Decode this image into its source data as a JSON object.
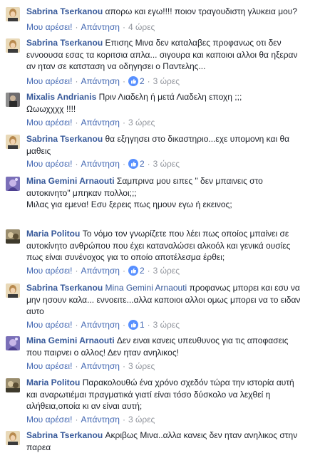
{
  "actions": {
    "like": "Μου αρέσει!",
    "reply": "Απάντηση",
    "sep": "·"
  },
  "colors": {
    "name": "#365899",
    "link": "#4267b2",
    "meta": "#90949c",
    "text": "#1d2129",
    "like_badge": "#5890ff"
  },
  "comments": [
    {
      "author": "Sabrina Tserkanou",
      "lines": [
        "απορω και εγω!!!! ποιον τραγουδιστη γλυκεια μου?"
      ],
      "reactions": "",
      "time": "4 ώρες"
    },
    {
      "author": "Sabrina Tserkanou",
      "lines": [
        "Επισης Μινα δεν καταλαβες προφανως οτι δεν",
        "εννοουσα εσας τα κοριτσια απλα... σιγουρα και καποιοι αλλοι θα ηξεραν",
        "αν ηταν σε κατσταση να οδηγησει ο Παντελης..."
      ],
      "reactions": "2",
      "time": "3 ώρες"
    },
    {
      "author": "Mixalis Andrianis",
      "lines": [
        "Πριν Λιαδελη ή μετά Λιαδελη εποχη ;;;",
        "Ωωωχχχχ !!!!"
      ],
      "reactions": "",
      "time": "3 ώρες"
    },
    {
      "author": "Sabrina Tserkanou",
      "lines": [
        "θα εξηγησει στο δικαστηριο...εχε υπομονη και θα",
        "μαθεις"
      ],
      "reactions": "2",
      "time": "3 ώρες"
    },
    {
      "author": "Mina Gemini Arnaouti",
      "lines": [
        "Σαμπρινα μου ειπες \" δεν μπαινεις στο",
        "αυτοκινητο\" μπηκαν πολλοι;;;",
        "Μιλας για εμενα! Εσυ ξερεις πως ημουν εγω ή εκεινος;"
      ],
      "reactions": "",
      "time": "3 ώρες"
    },
    {
      "author": "Maria Politou",
      "lines": [
        "Το νόμο τον γνωρίζετε που λέει πως οποίος μπαίνει σε",
        "αυτοκίνητο ανθρώπου που έχει καταναλώσει αλκοόλ και γενικά ουσίες",
        "πως είναι συνένοχος για το οποίο αποτέλεσμα έρθει;"
      ],
      "reactions": "2",
      "time": "3 ώρες"
    },
    {
      "author": "Sabrina Tserkanou",
      "mention": "Mina Gemini Arnaouti",
      "lines": [
        "προφανως μπορει και εσυ να",
        "μην ησουν καλα... εννοειτε...αλλα καποιοι αλλοι ομως μπορει να το ειδαν",
        "αυτο"
      ],
      "reactions": "1",
      "time": "3 ώρες"
    },
    {
      "author": "Mina Gemini Arnaouti",
      "lines": [
        "Δεν ειναι κανεις υπευθυνος για τις αποφασεις",
        "που παιρνει ο αλλος! Δεν ηταν ανηλικος!"
      ],
      "reactions": "",
      "time": "3 ώρες"
    },
    {
      "author": "Maria Politou",
      "lines": [
        "Παρακολουθώ ένα χρόνο σχεδόν τώρα την ιστορία αυτή",
        "και αναρωτιέμαι πραγματικά γιατί είναι τόσο δύσκολο να λεχθεί η",
        "αλήθεια,οποία κι αν είναι αυτή;"
      ],
      "reactions": "",
      "time": "3 ώρες"
    },
    {
      "author": "Sabrina Tserkanou",
      "lines": [
        "Ακριβως Μινα..αλλα κανεις δεν ηταν ανηλικος στην",
        "παρεα"
      ],
      "reactions": "",
      "time": ""
    }
  ]
}
